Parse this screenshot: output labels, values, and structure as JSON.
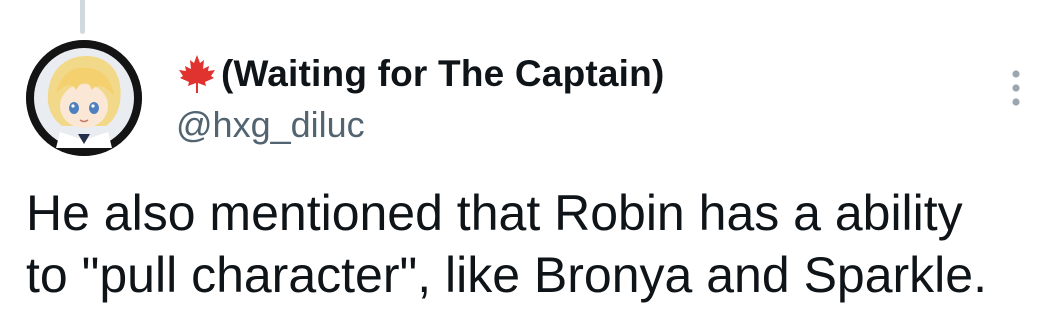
{
  "tweet": {
    "display_name": "(Waiting for The Captain)",
    "handle": "@hxg_diluc",
    "text_line1": "He also mentioned that Robin has a ability",
    "text_line2": "to \"pull character\", like Bronya and Sparkle."
  },
  "icons": {
    "name_emoji": "maple-leaf-icon",
    "menu": "more-vertical-icon",
    "avatar": "anime-avatar"
  },
  "colors": {
    "text": "#0f1419",
    "secondary": "#536471",
    "maple": "#e0322e",
    "thread_line": "#cfd9de"
  }
}
